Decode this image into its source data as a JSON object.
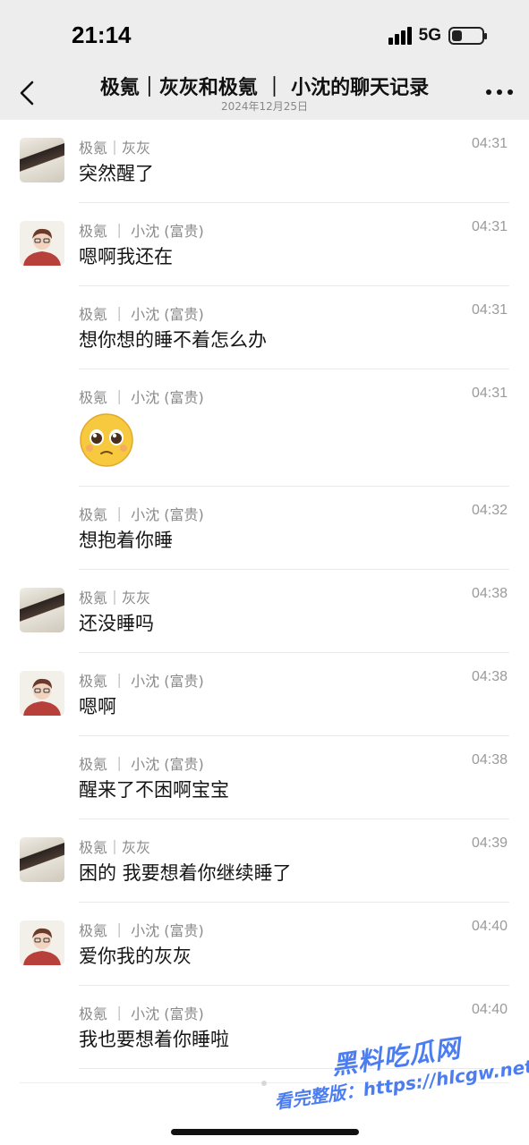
{
  "status_bar": {
    "time": "21:14",
    "network": "5G",
    "battery_level": 0.3
  },
  "header": {
    "title": "极氪｜灰灰和极氪 ｜ 小沈的聊天记录",
    "date": "2024年12月25日"
  },
  "messages": [
    {
      "sender": "极氪｜灰灰",
      "time": "04:31",
      "text": "突然醒了",
      "avatar": "hui"
    },
    {
      "sender": "极氪 ｜ 小沈 (富贵)",
      "time": "04:31",
      "text": "嗯啊我还在",
      "avatar": "shen"
    },
    {
      "sender": "极氪 ｜ 小沈 (富贵)",
      "time": "04:31",
      "text": "想你想的睡不着怎么办",
      "avatar": ""
    },
    {
      "sender": "极氪 ｜ 小沈 (富贵)",
      "time": "04:31",
      "text": "",
      "avatar": "",
      "emoji": "pleading-face"
    },
    {
      "sender": "极氪 ｜ 小沈 (富贵)",
      "time": "04:32",
      "text": "想抱着你睡",
      "avatar": ""
    },
    {
      "sender": "极氪｜灰灰",
      "time": "04:38",
      "text": "还没睡吗",
      "avatar": "hui"
    },
    {
      "sender": "极氪 ｜ 小沈 (富贵)",
      "time": "04:38",
      "text": "嗯啊",
      "avatar": "shen"
    },
    {
      "sender": "极氪 ｜ 小沈 (富贵)",
      "time": "04:38",
      "text": "醒来了不困啊宝宝",
      "avatar": ""
    },
    {
      "sender": "极氪｜灰灰",
      "time": "04:39",
      "text": "困的 我要想着你继续睡了",
      "avatar": "hui"
    },
    {
      "sender": "极氪 ｜ 小沈 (富贵)",
      "time": "04:40",
      "text": "爱你我的灰灰",
      "avatar": "shen"
    },
    {
      "sender": "极氪 ｜ 小沈 (富贵)",
      "time": "04:40",
      "text": "我也要想着你睡啦",
      "avatar": ""
    }
  ],
  "watermark": {
    "line1": "黑料吃瓜网",
    "line2": "看完整版：https://hlcgw.net"
  }
}
